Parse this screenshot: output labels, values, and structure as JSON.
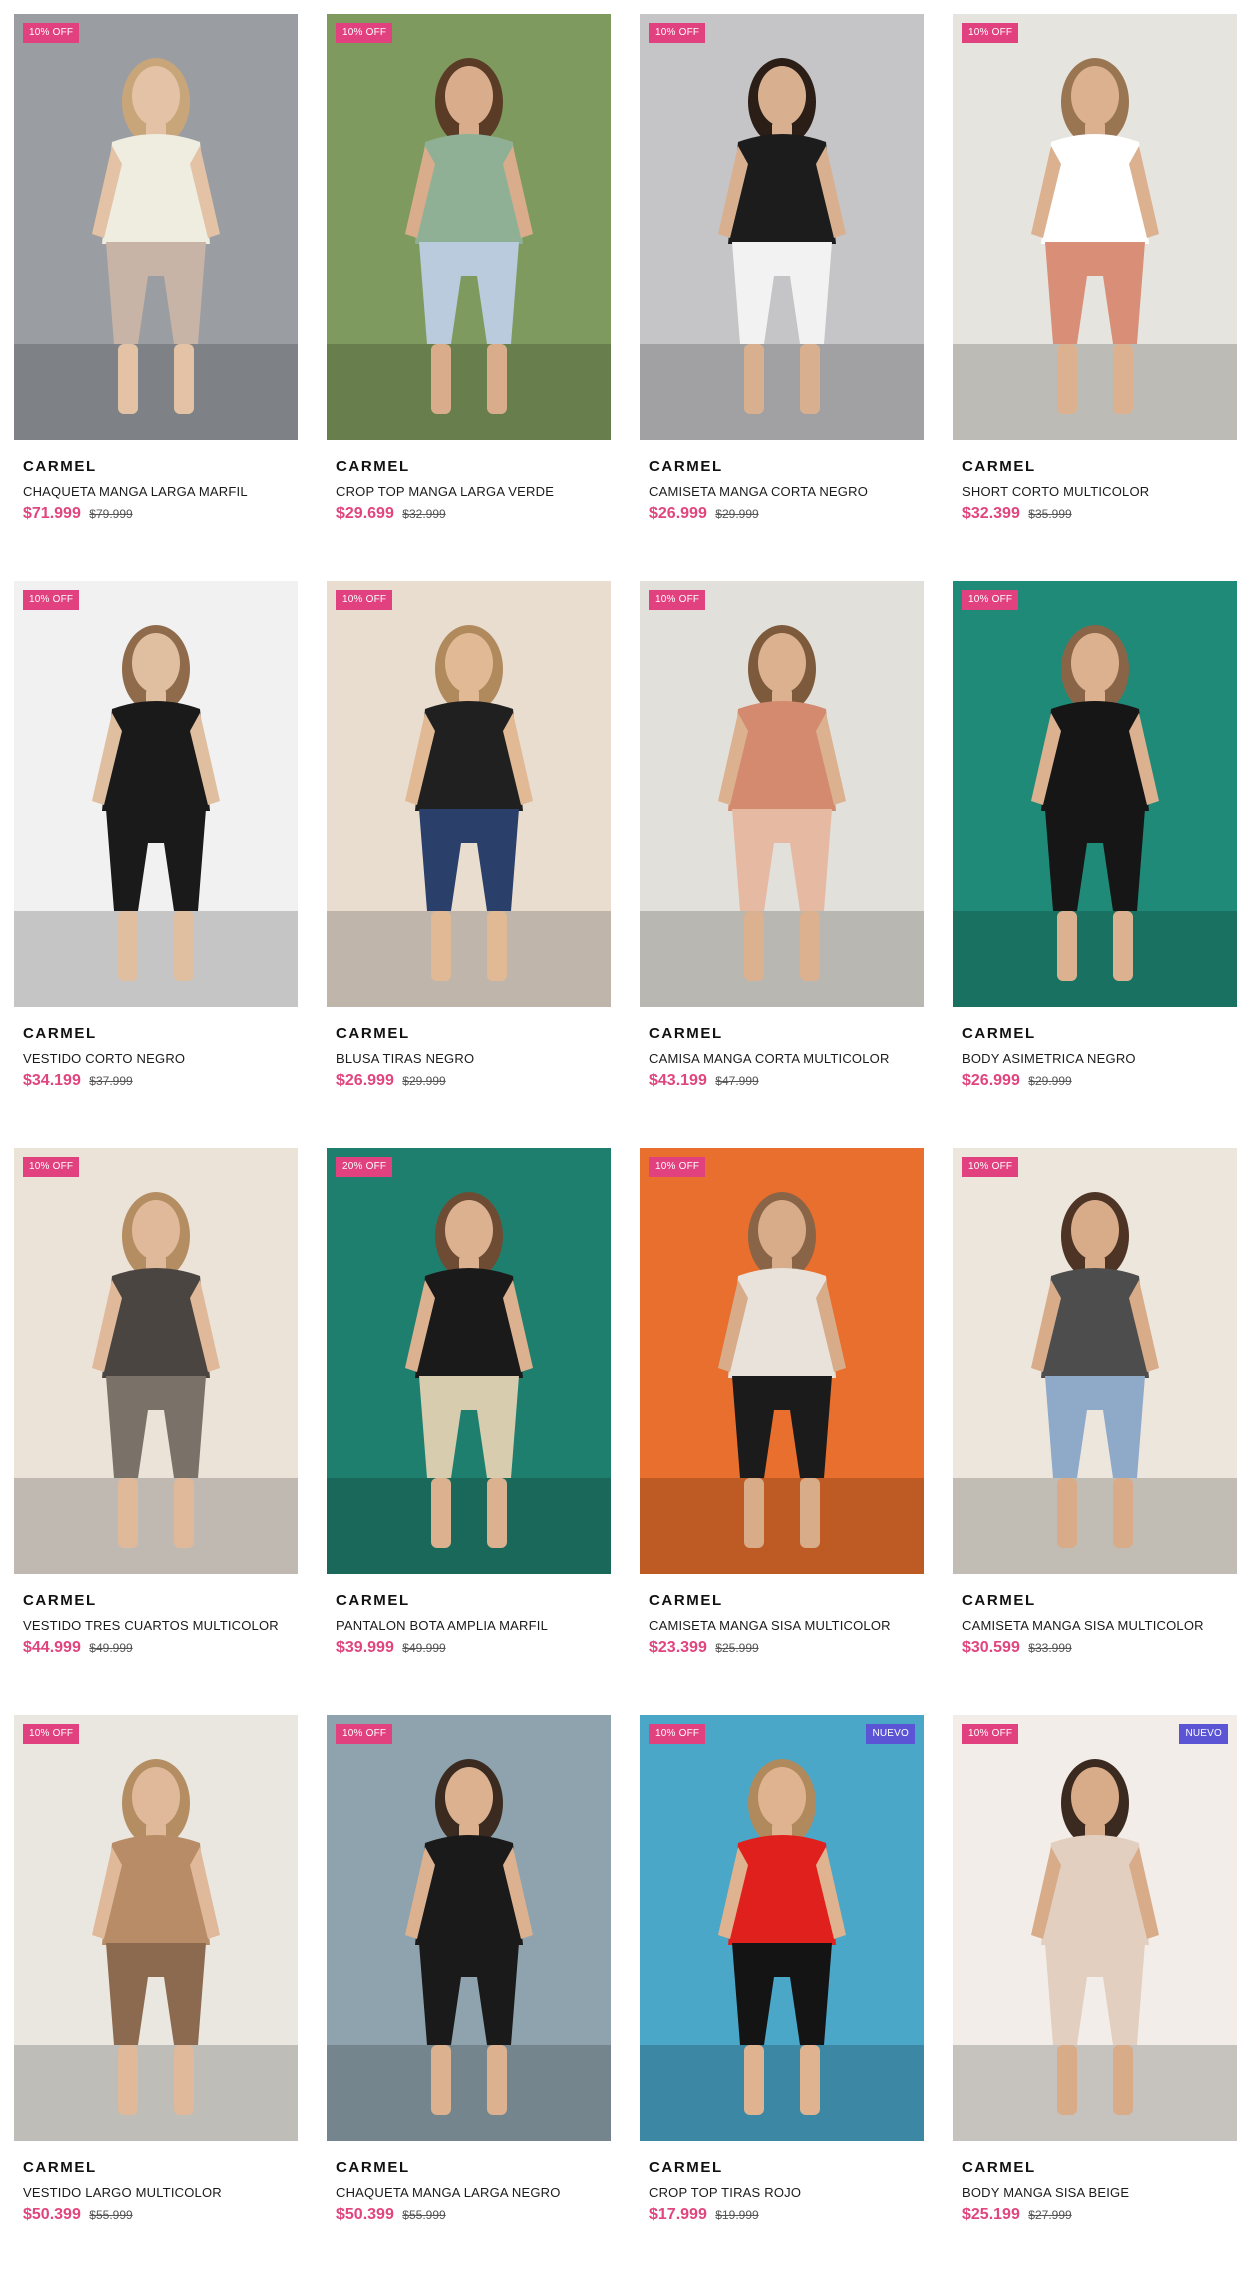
{
  "products": [
    {
      "brand": "CARMEL",
      "name": "CHAQUETA MANGA LARGA MARFIL",
      "price": "$71.999",
      "old_price": "$79.999",
      "badge": "10% OFF",
      "new_badge": "",
      "colors": {
        "bg": "#9a9ea3",
        "top": "#efece0",
        "bottom": "#c8b3a7",
        "skin": "#e3c2a5",
        "hair": "#c9a57a"
      }
    },
    {
      "brand": "CARMEL",
      "name": "CROP TOP MANGA LARGA VERDE",
      "price": "$29.699",
      "old_price": "$32.999",
      "badge": "10% OFF",
      "new_badge": "",
      "colors": {
        "bg": "#7f9a5e",
        "top": "#8fb095",
        "bottom": "#b9cbdc",
        "skin": "#d9ad8c",
        "hair": "#5a3b26"
      }
    },
    {
      "brand": "CARMEL",
      "name": "CAMISETA MANGA CORTA NEGRO",
      "price": "$26.999",
      "old_price": "$29.999",
      "badge": "10% OFF",
      "new_badge": "",
      "colors": {
        "bg": "#c5c5c7",
        "top": "#1c1c1c",
        "bottom": "#f2f2f2",
        "skin": "#d8b08f",
        "hair": "#2a1e17"
      }
    },
    {
      "brand": "CARMEL",
      "name": "SHORT CORTO MULTICOLOR",
      "price": "$32.399",
      "old_price": "$35.999",
      "badge": "10% OFF",
      "new_badge": "",
      "colors": {
        "bg": "#e6e4df",
        "top": "#ffffff",
        "bottom": "#d98f77",
        "skin": "#dcb190",
        "hair": "#9a7552"
      }
    },
    {
      "brand": "CARMEL",
      "name": "VESTIDO CORTO NEGRO",
      "price": "$34.199",
      "old_price": "$37.999",
      "badge": "10% OFF",
      "new_badge": "",
      "colors": {
        "bg": "#f1f1f1",
        "top": "#1a1a1a",
        "bottom": "#1a1a1a",
        "skin": "#e0bea0",
        "hair": "#8f6b4b"
      }
    },
    {
      "brand": "CARMEL",
      "name": "BLUSA TIRAS NEGRO",
      "price": "$26.999",
      "old_price": "$29.999",
      "badge": "10% OFF",
      "new_badge": "",
      "colors": {
        "bg": "#e9ddd0",
        "top": "#202020",
        "bottom": "#2b3f6b",
        "skin": "#e1b995",
        "hair": "#b08a5c"
      }
    },
    {
      "brand": "CARMEL",
      "name": "CAMISA MANGA CORTA MULTICOLOR",
      "price": "$43.199",
      "old_price": "$47.999",
      "badge": "10% OFF",
      "new_badge": "",
      "colors": {
        "bg": "#e2e0da",
        "top": "#d48a6e",
        "bottom": "#e6b9a3",
        "skin": "#dbb190",
        "hair": "#7d5a3c"
      }
    },
    {
      "brand": "CARMEL",
      "name": "BODY ASIMETRICA NEGRO",
      "price": "$26.999",
      "old_price": "$29.999",
      "badge": "10% OFF",
      "new_badge": "",
      "colors": {
        "bg": "#1f8a78",
        "top": "#161616",
        "bottom": "#161616",
        "skin": "#dcb190",
        "hair": "#8a6446"
      }
    },
    {
      "brand": "CARMEL",
      "name": "VESTIDO TRES CUARTOS MULTICOLOR",
      "price": "$44.999",
      "old_price": "$49.999",
      "badge": "10% OFF",
      "new_badge": "",
      "colors": {
        "bg": "#ebe2d8",
        "top": "#4a4540",
        "bottom": "#7a7268",
        "skin": "#e0b99a",
        "hair": "#b48e62"
      }
    },
    {
      "brand": "CARMEL",
      "name": "PANTALON BOTA AMPLIA MARFIL",
      "price": "$39.999",
      "old_price": "$49.999",
      "badge": "20% OFF",
      "new_badge": "",
      "colors": {
        "bg": "#1f7f6e",
        "top": "#1a1a1a",
        "bottom": "#d8ccae",
        "skin": "#dbb190",
        "hair": "#6e4c33"
      }
    },
    {
      "brand": "CARMEL",
      "name": "CAMISETA MANGA SISA MULTICOLOR",
      "price": "$23.399",
      "old_price": "$25.999",
      "badge": "10% OFF",
      "new_badge": "",
      "colors": {
        "bg": "#e86f2e",
        "top": "#e8e2da",
        "bottom": "#1b1b1b",
        "skin": "#d8ab89",
        "hair": "#8a6446"
      }
    },
    {
      "brand": "CARMEL",
      "name": "CAMISETA MANGA SISA MULTICOLOR",
      "price": "$30.599",
      "old_price": "$33.999",
      "badge": "10% OFF",
      "new_badge": "",
      "colors": {
        "bg": "#ece6dc",
        "top": "#4d4d4d",
        "bottom": "#8fa9c9",
        "skin": "#d8ab89",
        "hair": "#4e3424"
      }
    },
    {
      "brand": "CARMEL",
      "name": "VESTIDO LARGO MULTICOLOR",
      "price": "$50.399",
      "old_price": "$55.999",
      "badge": "10% OFF",
      "new_badge": "",
      "colors": {
        "bg": "#eae7e1",
        "top": "#b78c66",
        "bottom": "#8c6a4f",
        "skin": "#e0b99a",
        "hair": "#b48e62"
      }
    },
    {
      "brand": "CARMEL",
      "name": "CHAQUETA MANGA LARGA NEGRO",
      "price": "$50.399",
      "old_price": "$55.999",
      "badge": "10% OFF",
      "new_badge": "",
      "colors": {
        "bg": "#8ea3ad",
        "top": "#1a1a1a",
        "bottom": "#1a1a1a",
        "skin": "#dbb190",
        "hair": "#3a2a20"
      }
    },
    {
      "brand": "CARMEL",
      "name": "CROP TOP TIRAS ROJO",
      "price": "$17.999",
      "old_price": "$19.999",
      "badge": "10% OFF",
      "new_badge": "NUEVO",
      "colors": {
        "bg": "#4aa7c8",
        "top": "#e0201c",
        "bottom": "#141414",
        "skin": "#dfb38f",
        "hair": "#b08a5c"
      }
    },
    {
      "brand": "CARMEL",
      "name": "BODY MANGA SISA BEIGE",
      "price": "$25.199",
      "old_price": "$27.999",
      "badge": "10% OFF",
      "new_badge": "NUEVO",
      "colors": {
        "bg": "#f2ede8",
        "top": "#e3cfbf",
        "bottom": "#e3cfbf",
        "skin": "#d8ab89",
        "hair": "#3a2a20"
      }
    }
  ]
}
